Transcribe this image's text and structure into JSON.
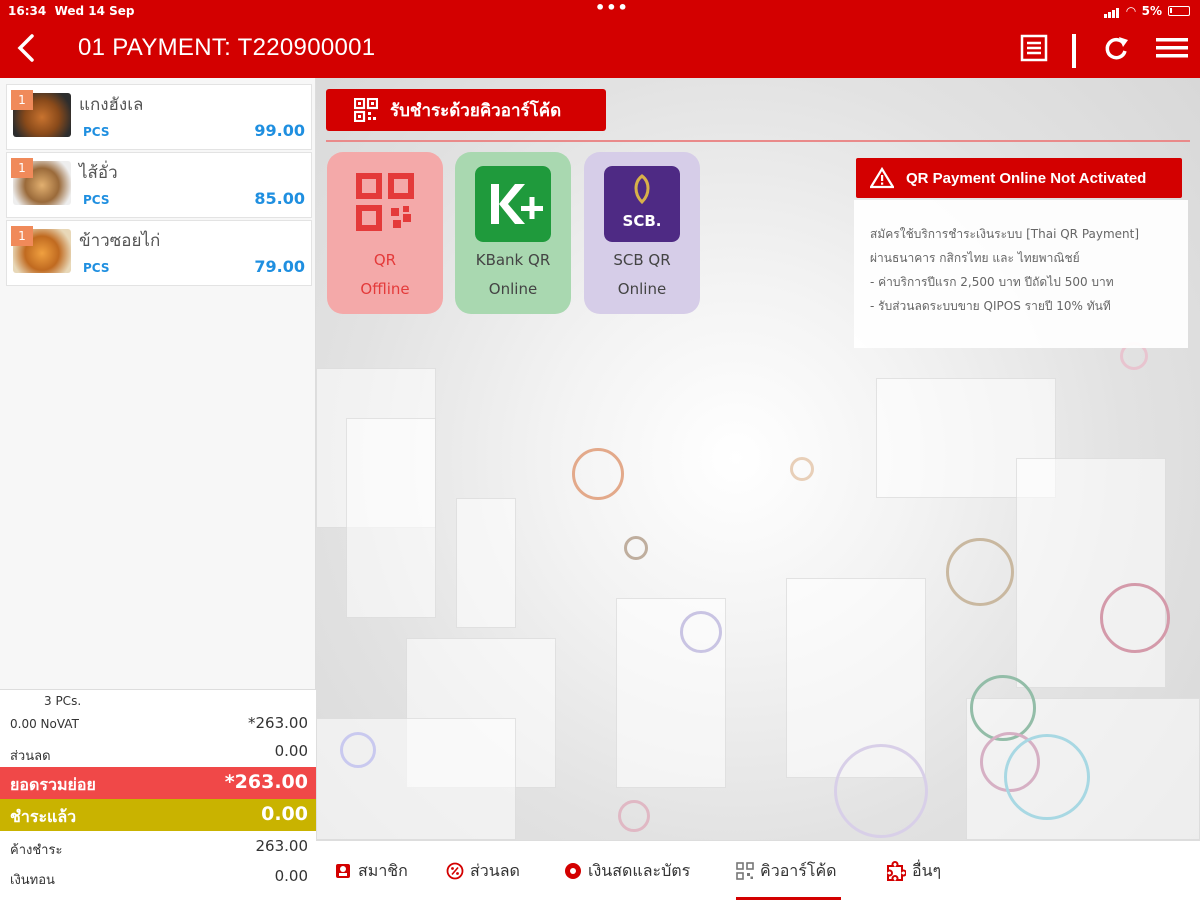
{
  "status_bar": {
    "time": "16:34",
    "date": "Wed 14 Sep",
    "battery": "5%"
  },
  "header": {
    "title": "01 PAYMENT: T220900001"
  },
  "order_items": [
    {
      "qty": "1",
      "name": "แกงฮังเล",
      "unit": "PCS",
      "price": "99.00"
    },
    {
      "qty": "1",
      "name": "ไส้อั่ว",
      "unit": "PCS",
      "price": "85.00"
    },
    {
      "qty": "1",
      "name": "ข้าวซอยไก่",
      "unit": "PCS",
      "price": "79.00"
    }
  ],
  "summary": {
    "pcs": "3 PCs.",
    "novat_label": "0.00 NoVAT",
    "novat_value": "*263.00",
    "discount_label": "ส่วนลด",
    "discount_value": "0.00",
    "subtotal_label": "ยอดรวมย่อย",
    "subtotal_value": "*263.00",
    "paid_label": "ชำระแล้ว",
    "paid_value": "0.00",
    "due_label": "ค้างชำระ",
    "due_value": "263.00",
    "change_label": "เงินทอน",
    "change_value": "0.00"
  },
  "qr_header": "รับชำระด้วยคิวอาร์โค้ด",
  "qr_options": [
    {
      "line1": "QR",
      "line2": "Offline"
    },
    {
      "line1": "KBank QR",
      "line2": "Online"
    },
    {
      "line1": "SCB QR",
      "line2": "Online"
    }
  ],
  "warning": {
    "title": "QR Payment Online Not Activated",
    "lines": [
      "สมัครใช้บริการชำระเงินระบบ [Thai QR Payment]",
      "ผ่านธนาคาร กสิกรไทย และ ไทยพาณิชย์",
      " - ค่าบริการปีแรก 2,500 บาท ปีถัดไป 500 บาท",
      " - รับส่วนลดระบบขาย QIPOS รายปี 10% ทันที"
    ]
  },
  "tabs": [
    {
      "label": "สมาชิก",
      "icon": "member-card-icon"
    },
    {
      "label": "ส่วนลด",
      "icon": "discount-icon"
    },
    {
      "label": "เงินสดและบัตร",
      "icon": "cash-card-icon"
    },
    {
      "label": "คิวอาร์โค้ด",
      "icon": "qr-code-icon",
      "active": true
    },
    {
      "label": "อื่นๆ",
      "icon": "puzzle-icon"
    }
  ],
  "colors": {
    "brand_red": "#d30000",
    "paid_band": "#c9b300",
    "subtotal_band": "#f04848",
    "price_blue": "#1f8fe0"
  }
}
